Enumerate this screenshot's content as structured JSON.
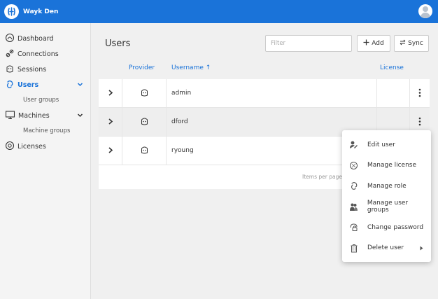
{
  "app": {
    "name": "Wayk Den"
  },
  "sidebar": {
    "items": [
      {
        "label": "Dashboard",
        "icon": "gauge-icon"
      },
      {
        "label": "Connections",
        "icon": "link-icon"
      },
      {
        "label": "Sessions",
        "icon": "sessions-icon"
      },
      {
        "label": "Users",
        "icon": "users-icon",
        "active": true
      },
      {
        "label": "Machines",
        "icon": "monitor-icon"
      },
      {
        "label": "Licenses",
        "icon": "license-icon"
      }
    ],
    "subitems": {
      "users": "User groups",
      "machines": "Machine groups"
    }
  },
  "users_page": {
    "title": "Users",
    "filter_placeholder": "Filter",
    "add_label": "Add",
    "sync_label": "Sync",
    "columns": {
      "provider": "Provider",
      "username": "Username ↑",
      "license": "License"
    },
    "rows": [
      {
        "username": "admin"
      },
      {
        "username": "dford"
      },
      {
        "username": "ryoung"
      }
    ],
    "items_per_page": "Items per page"
  },
  "context_menu": {
    "items": [
      {
        "label": "Edit user",
        "icon": "edit-user-icon"
      },
      {
        "label": "Manage license",
        "icon": "license-icon"
      },
      {
        "label": "Manage role",
        "icon": "role-icon"
      },
      {
        "label": "Manage user groups",
        "icon": "user-groups-icon"
      },
      {
        "label": "Change password",
        "icon": "password-icon"
      },
      {
        "label": "Delete user",
        "icon": "trash-icon",
        "has_submenu": true
      }
    ]
  },
  "colors": {
    "brand": "#1a73d9",
    "sidebar_bg": "#f4f4f4",
    "page_bg": "#f0f0f0"
  }
}
